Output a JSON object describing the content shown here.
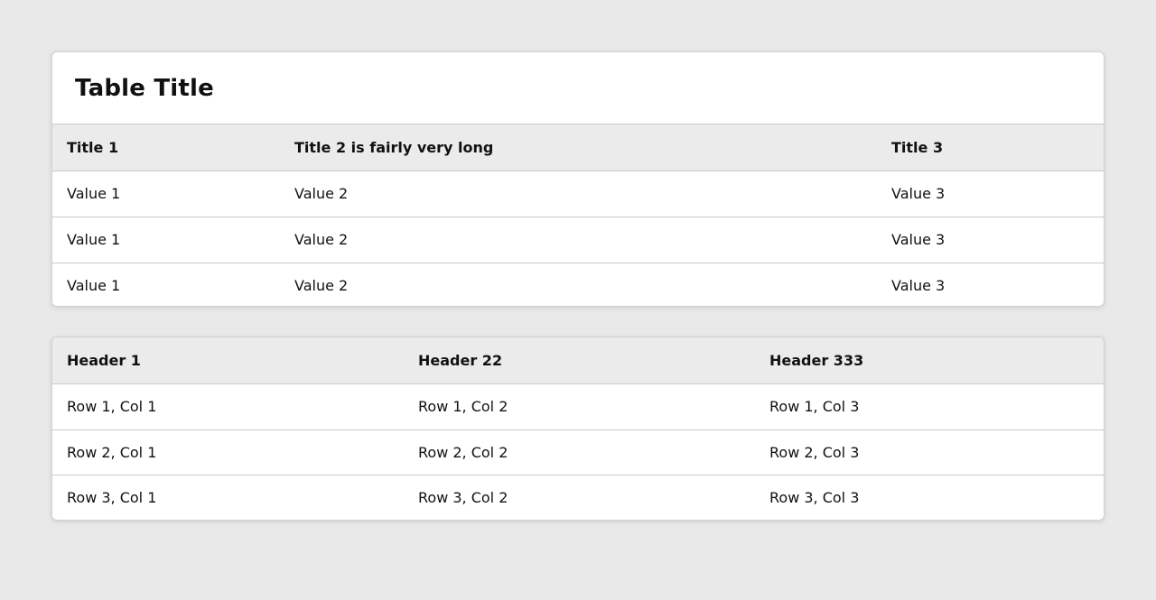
{
  "table1": {
    "title": "Table Title",
    "headers": [
      "Title 1",
      "Title 2 is fairly very long",
      "Title 3"
    ],
    "rows": [
      [
        "Value 1",
        "Value 2",
        "Value 3"
      ],
      [
        "Value 1",
        "Value 2",
        "Value 3"
      ],
      [
        "Value 1",
        "Value 2",
        "Value 3"
      ]
    ]
  },
  "table2": {
    "headers": [
      "Header 1",
      "Header 22",
      "Header 333"
    ],
    "rows": [
      [
        "Row 1, Col 1",
        "Row 1, Col 2",
        "Row 1, Col 3"
      ],
      [
        "Row 2, Col 1",
        "Row 2, Col 2",
        "Row 2, Col 3"
      ],
      [
        "Row 3, Col 1",
        "Row 3, Col 2",
        "Row 3, Col 3"
      ]
    ]
  },
  "colors": {
    "page_background": "#e9e9e9",
    "card_background": "#ffffff",
    "header_row_background": "#ebebeb",
    "divider": "#c8c8c8"
  }
}
